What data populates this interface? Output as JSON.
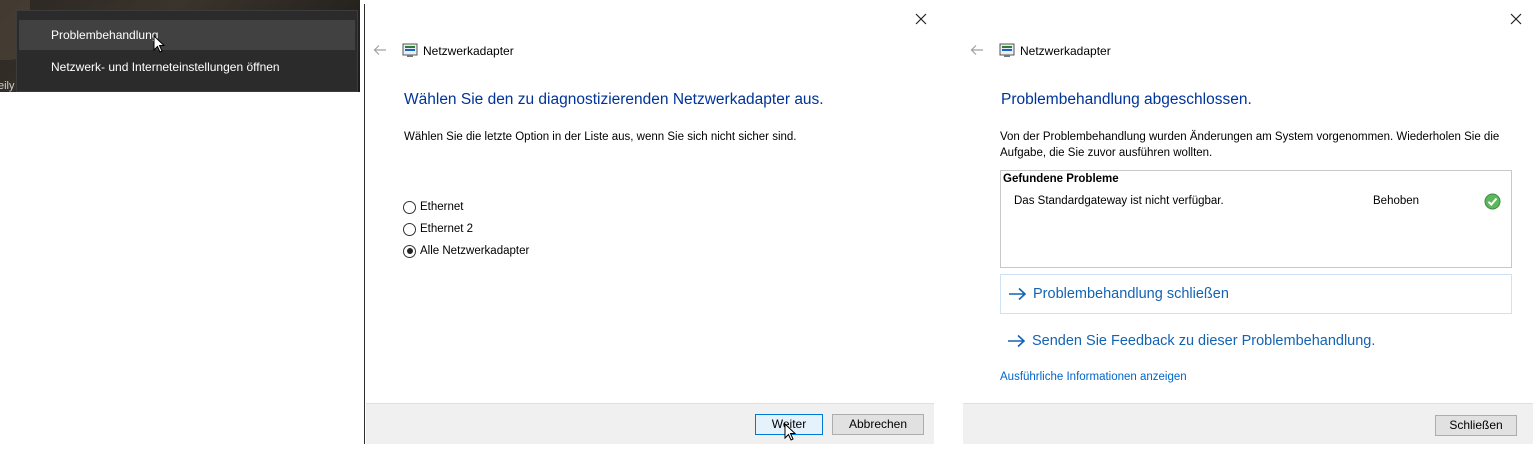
{
  "context_menu": {
    "desktop_edge_text": "eily",
    "items": [
      {
        "label": "Problembehandlung"
      },
      {
        "label": "Netzwerk- und Interneteinstellungen öffnen"
      }
    ]
  },
  "dialog_select": {
    "header_title": "Netzwerkadapter",
    "heading": "Wählen Sie den zu diagnostizierenden Netzwerkadapter aus.",
    "instruction": "Wählen Sie die letzte Option in der Liste aus, wenn Sie sich nicht sicher sind.",
    "options": [
      {
        "label": "Ethernet",
        "checked": false
      },
      {
        "label": "Ethernet 2",
        "checked": false
      },
      {
        "label": "Alle Netzwerkadapter",
        "checked": true
      }
    ],
    "next_label": "Weiter",
    "cancel_label": "Abbrechen"
  },
  "dialog_result": {
    "header_title": "Netzwerkadapter",
    "heading": "Problembehandlung abgeschlossen.",
    "description": "Von der Problembehandlung wurden Änderungen am System vorgenommen. Wiederholen Sie die Aufgabe, die Sie zuvor ausführen wollten.",
    "problems_title": "Gefundene Probleme",
    "problem": {
      "description": "Das Standardgateway ist nicht verfügbar.",
      "status": "Behoben"
    },
    "close_troubleshooter_label": "Problembehandlung schließen",
    "feedback_label": "Senden Sie Feedback zu dieser Problembehandlung.",
    "details_label": "Ausführliche Informationen anzeigen",
    "close_label": "Schließen"
  },
  "colors": {
    "heading_blue": "#003399",
    "link_blue": "#1463b3",
    "accent": "#0078d7",
    "menu_bg": "#2b2b2b",
    "success_green": "#4caf50"
  },
  "icons": {
    "back": "back-arrow-icon",
    "close": "close-icon",
    "network": "network-adapter-icon",
    "check": "check-icon",
    "arrow": "arrow-right-icon",
    "cursor": "mouse-cursor-icon"
  }
}
